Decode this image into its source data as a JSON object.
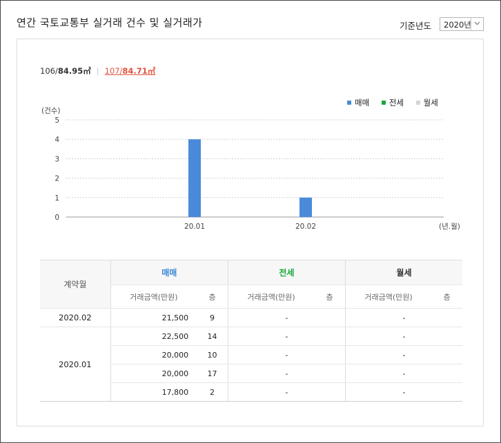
{
  "header": {
    "title": "연간 국토교통부 실거래 건수 및 실거래가",
    "year_label": "기준년도",
    "year_value": "2020년"
  },
  "area_tabs": {
    "tab1_prefix": "106/",
    "tab1_area": "84.95㎡",
    "tab2_prefix": "107/",
    "tab2_area": "84.71㎡"
  },
  "legend": [
    {
      "name": "매매",
      "color": "#4a8ad8"
    },
    {
      "name": "전세",
      "color": "#1aa83c"
    },
    {
      "name": "월세",
      "color": "#d6d6d6"
    }
  ],
  "chart_data": {
    "type": "bar",
    "ylabel": "(건수)",
    "xlabel": "(년.월)",
    "ylim": [
      0,
      5
    ],
    "yticks": [
      "0",
      "1",
      "2",
      "3",
      "4",
      "5"
    ],
    "categories": [
      "20.01",
      "20.02"
    ],
    "series": [
      {
        "name": "매매",
        "values": [
          4,
          1
        ],
        "color": "#4a8ad8"
      }
    ],
    "grid": true
  },
  "table": {
    "col_month": "계약월",
    "groups": [
      {
        "name": "매매",
        "color": "#3a86d6"
      },
      {
        "name": "전세",
        "color": "#1aa83c"
      },
      {
        "name": "월세",
        "color": "#333333"
      }
    ],
    "sub_price": "거래금액(만원)",
    "sub_floor": "층",
    "rows": [
      {
        "month": "2020.02",
        "price": "21,500",
        "floor": "9",
        "jeonse": "-",
        "wolse": "-"
      },
      {
        "month": "2020.01",
        "price": "22,500",
        "floor": "14",
        "jeonse": "-",
        "wolse": "-"
      },
      {
        "month": "",
        "price": "20,000",
        "floor": "10",
        "jeonse": "-",
        "wolse": "-"
      },
      {
        "month": "",
        "price": "20,000",
        "floor": "17",
        "jeonse": "-",
        "wolse": "-"
      },
      {
        "month": "",
        "price": "17,800",
        "floor": "2",
        "jeonse": "-",
        "wolse": "-"
      }
    ]
  }
}
